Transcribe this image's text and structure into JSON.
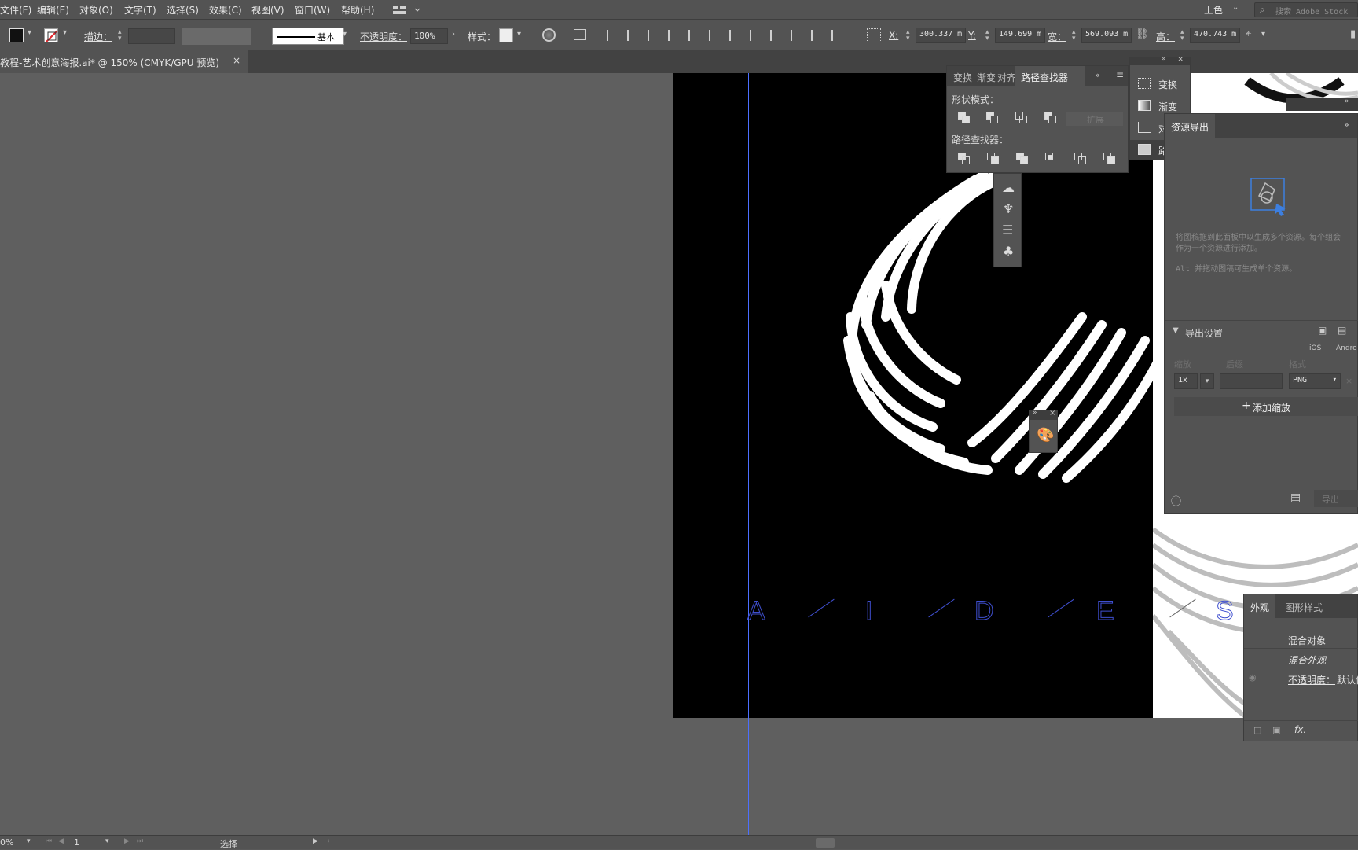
{
  "menubar": {
    "items": [
      "文件(F)",
      "编辑(E)",
      "对象(O)",
      "文字(T)",
      "选择(S)",
      "效果(C)",
      "视图(V)",
      "窗口(W)",
      "帮助(H)"
    ],
    "workspace": "上色",
    "search_placeholder": "搜索 Adobe Stock"
  },
  "controlbar": {
    "stroke_label": "描边：",
    "stroke_profile": "基本",
    "opacity_label": "不透明度：",
    "opacity_value": "100%",
    "style_label": "样式：",
    "x_label": "X:",
    "x_value": "300.337 m",
    "y_label": "Y:",
    "y_value": "149.699 m",
    "w_label": "宽：",
    "w_value": "569.093 m",
    "h_label": "高：",
    "h_value": "470.743 m"
  },
  "document": {
    "tab_title": "教程-艺术创意海报.ai* @ 150% (CMYK/GPU 预览)",
    "close": "×"
  },
  "artwork": {
    "letters": [
      "A",
      "I",
      "D",
      "E",
      "S"
    ]
  },
  "pathfinder_panel": {
    "tabs": [
      "变换",
      "渐变",
      "对齐",
      "路径查找器"
    ],
    "shape_modes_label": "形状模式：",
    "expand_label": "扩展",
    "pathfinders_label": "路径查找器："
  },
  "dock": {
    "items": [
      {
        "label": "变换",
        "icon": "transform-icon"
      },
      {
        "label": "渐变",
        "icon": "gradient-icon"
      },
      {
        "label": "对",
        "icon": "align-icon"
      },
      {
        "label": "路",
        "icon": "pathfinder-icon"
      }
    ]
  },
  "asset_export": {
    "title": "资源导出",
    "hint_line1": "将图稿拖到此面板中以生成多个资源。每个组会",
    "hint_line2": "作为一个资源进行添加。",
    "hint_line3": "Alt 并拖动图稿可生成单个资源。",
    "export_settings": "导出设置",
    "ios": "iOS",
    "android": "Andro",
    "col_scale": "缩放",
    "col_suffix": "后缀",
    "col_format": "格式",
    "scale_value": "1x",
    "format_value": "PNG",
    "add_scale": "添加缩放",
    "export_button": "导出"
  },
  "appearance_panel": {
    "tabs": [
      "外观",
      "图形样式"
    ],
    "row1": "混合对象",
    "row2": "混合外观",
    "opacity_label": "不透明度：",
    "opacity_value": "默认值",
    "fx": "fx."
  },
  "statusbar": {
    "zoom": "0%",
    "page": "1",
    "tool": "选择"
  }
}
